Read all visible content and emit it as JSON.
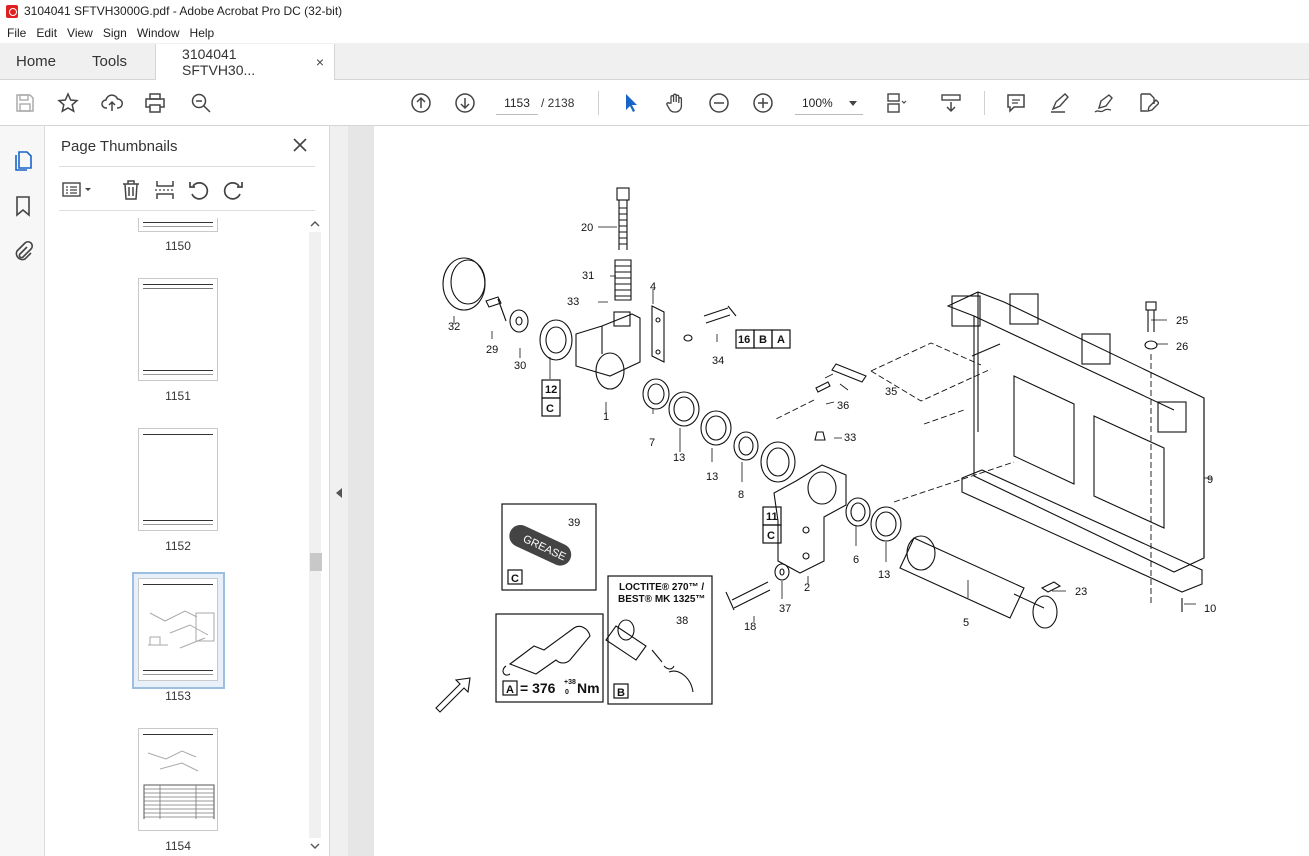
{
  "window": {
    "title": "3104041 SFTVH3000G.pdf - Adobe Acrobat Pro DC (32-bit)"
  },
  "menu": [
    "File",
    "Edit",
    "View",
    "Sign",
    "Window",
    "Help"
  ],
  "tabs": {
    "home": "Home",
    "tools": "Tools",
    "document": "3104041 SFTVH30...",
    "close": "×"
  },
  "toolbar": {
    "current_page": "1153",
    "total_pages": "/ 2138",
    "zoom": "100%"
  },
  "panel": {
    "title": "Page Thumbnails",
    "thumbnails": [
      {
        "label": "1150"
      },
      {
        "label": "1151"
      },
      {
        "label": "1152"
      },
      {
        "label": "1153",
        "selected": true
      },
      {
        "label": "1154"
      }
    ]
  },
  "drawing": {
    "part_numbers": [
      "20",
      "31",
      "33",
      "4",
      "32",
      "29",
      "30",
      "12",
      "C",
      "1",
      "16",
      "B",
      "A",
      "34",
      "7",
      "13",
      "13",
      "8",
      "11",
      "C",
      "33",
      "35",
      "36",
      "25",
      "26",
      "9",
      "2",
      "6",
      "13",
      "5",
      "23",
      "10",
      "18",
      "37",
      "39",
      "C",
      "38",
      "B",
      "A"
    ],
    "grease_text": "GREASE",
    "loctite_line1": "LOCTITE® 270™ /",
    "loctite_line2": "BEST® MK 1325™",
    "torque_text": "= 376",
    "torque_sup": "+38",
    "torque_sub": "0",
    "torque_unit": "Nm"
  }
}
